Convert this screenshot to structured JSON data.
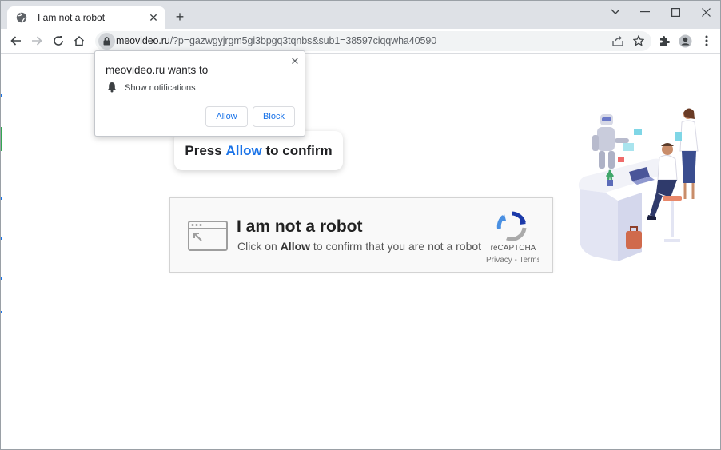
{
  "tab": {
    "title": "I am not a robot",
    "favicon": "globe-icon"
  },
  "toolbar": {
    "url_host": "meovideo.ru",
    "url_path": "/?p=gazwgyjrgm5gi3bpgq3tqnbs&sub1=38597ciqqwha40590"
  },
  "popup": {
    "title": "meovideo.ru wants to",
    "permission": "Show notifications",
    "allow_label": "Allow",
    "block_label": "Block"
  },
  "press_card": {
    "prefix": "Press",
    "highlight": "Allow",
    "suffix": "to confirm"
  },
  "captcha": {
    "heading": "I am not a robot",
    "sub_prefix": "Click on",
    "sub_bold": "Allow",
    "sub_suffix": "to confirm that you are not a robot",
    "brand": "reCAPTCHA",
    "links": "Privacy - Terms"
  },
  "colors": {
    "accent": "#1a73e8",
    "chrome_frame": "#dee1e6"
  }
}
